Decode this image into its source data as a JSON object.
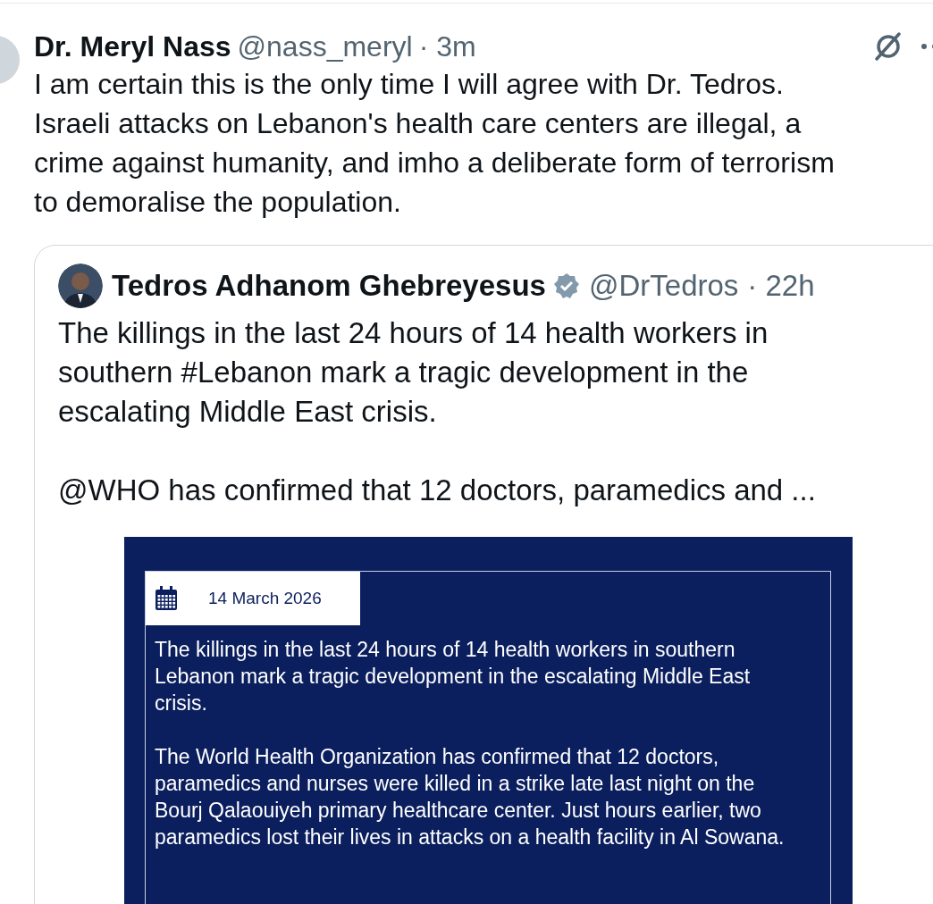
{
  "post": {
    "author": "Dr. Meryl Nass",
    "handle": "@nass_meryl",
    "time": "· 3m",
    "text": "I am certain this is the only time I will agree with Dr. Tedros. Israeli attacks on Lebanon's health care centers are illegal, a crime against humanity, and imho a deliberate form of terrorism to demoralise the population."
  },
  "quote": {
    "author": "Tedros Adhanom Ghebreyesus",
    "verified": true,
    "handle": "@DrTedros",
    "time": "· 22h",
    "paragraphs": [
      "The killings in the last 24 hours of 14 health workers in southern #Lebanon mark a tragic development in the escalating Middle East crisis.",
      "@WHO has confirmed that 12 doctors, paramedics and ..."
    ],
    "image": {
      "date": "14 March 2026",
      "paragraphs": [
        "The killings in the last 24 hours of 14 health workers in southern Lebanon mark a tragic development in the escalating Middle East crisis.",
        "The World Health Organization has confirmed that 12 doctors, paramedics and nurses were killed in a strike late last night on the Bourj Qalaouiyeh primary healthcare center. Just hours earlier, two paramedics lost their lives in attacks on a health facility in Al Sowana."
      ]
    }
  }
}
